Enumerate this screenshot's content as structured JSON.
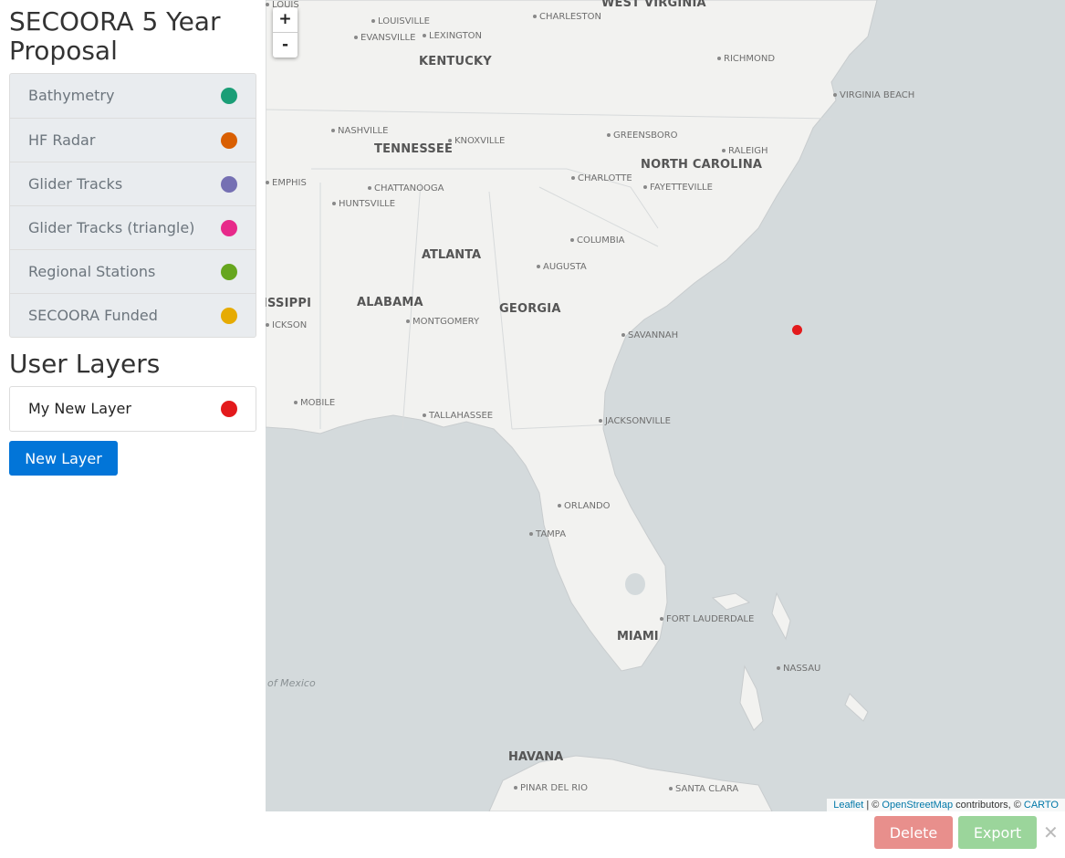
{
  "sidebar": {
    "title": "SECOORA 5 Year Proposal",
    "base_layers": [
      {
        "label": "Bathymetry",
        "color": "#1b9e77"
      },
      {
        "label": "HF Radar",
        "color": "#d95f02"
      },
      {
        "label": "Glider Tracks",
        "color": "#7570b3"
      },
      {
        "label": "Glider Tracks (triangle)",
        "color": "#e7298a"
      },
      {
        "label": "Regional Stations",
        "color": "#66a61e"
      },
      {
        "label": "SECOORA Funded",
        "color": "#e6ab02"
      }
    ],
    "user_layers_title": "User Layers",
    "user_layers": [
      {
        "label": "My New Layer",
        "color": "#e31a1c"
      }
    ],
    "new_layer_label": "New Layer"
  },
  "map": {
    "zoom_in": "+",
    "zoom_out": "-",
    "states": [
      "WEST VIRGINIA",
      "KENTUCKY",
      "TENNESSEE",
      "NORTH CAROLINA",
      "ALABAMA",
      "GEORGIA",
      "ISSIPPI"
    ],
    "cities": [
      "LOUIS",
      "LOUISVILLE",
      "CHARLESTON",
      "EVANSVILLE",
      "LEXINGTON",
      "RICHMOND",
      "VIRGINIA BEACH",
      "NASHVILLE",
      "KNOXVILLE",
      "GREENSBORO",
      "RALEIGH",
      "EMPHIS",
      "CHARLOTTE",
      "FAYETTEVILLE",
      "HUNTSVILLE",
      "CHATTANOOGA",
      "ATLANTA",
      "COLUMBIA",
      "AUGUSTA",
      "MONTGOMERY",
      "ICKSON",
      "SAVANNAH",
      "MOBILE",
      "TALLAHASSEE",
      "JACKSONVILLE",
      "ORLANDO",
      "TAMPA",
      "FORT LAUDERDALE",
      "MIAMI",
      "NASSAU",
      "HAVANA",
      "PINAR DEL RIO",
      "SANTA CLARA"
    ],
    "water": [
      "of Mexico"
    ],
    "attribution": {
      "leaflet": "Leaflet",
      "sep": " | © ",
      "osm": "OpenStreetMap",
      "mid": " contributors, © ",
      "carto": "CARTO"
    }
  },
  "actions": {
    "delete_label": "Delete",
    "export_label": "Export",
    "close_label": "✕"
  }
}
